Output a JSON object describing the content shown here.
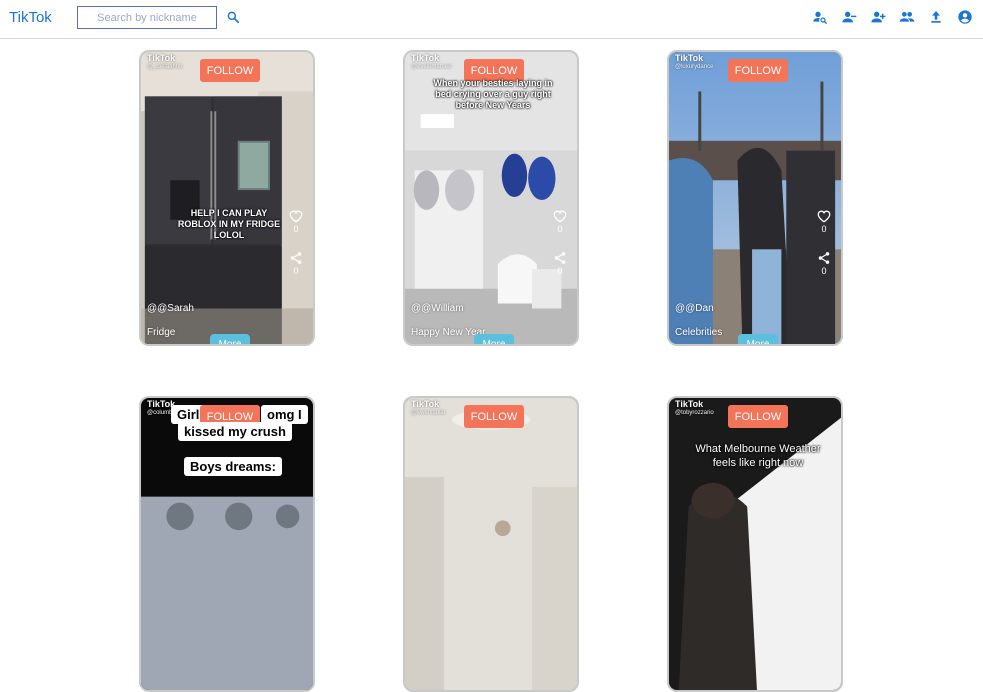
{
  "header": {
    "brand": "TikTok",
    "search_placeholder": "Search by nickname"
  },
  "colors": {
    "brand_blue": "#1976d2",
    "follow_orange": "#f4745a",
    "more_teal": "#5bc0de"
  },
  "toolbar_icons": [
    "person-search-icon",
    "person-remove-icon",
    "person-add-icon",
    "group-icon",
    "upload-icon",
    "account-circle-icon"
  ],
  "cards": [
    {
      "watermark": "TikTok",
      "handle": "@_bellaahhh",
      "follow": "FOLLOW",
      "overlay": [
        "HELP I CAN PLAY",
        "ROBLOX IN MY FRIDGE",
        "LOLOL"
      ],
      "likes": "0",
      "shares": "0",
      "username": "@@Sarah",
      "caption": "Fridge",
      "more": "More"
    },
    {
      "watermark": "TikTok",
      "handle": "@evelemarsee",
      "follow": "FOLLOW",
      "overlay": [
        "When your besties laying in",
        "bed crying over a guy right",
        "before New Years"
      ],
      "likes": "0",
      "shares": "0",
      "username": "@@William",
      "caption": "Happy New Year",
      "more": "More"
    },
    {
      "watermark": "TikTok",
      "handle": "@luxurydance",
      "follow": "FOLLOW",
      "likes": "0",
      "shares": "0",
      "username": "@@Dan",
      "caption": "Celebrities",
      "more": "More"
    },
    {
      "watermark": "TikTok",
      "handle": "@columbe",
      "follow": "FOLLOW",
      "overlay_top": "Girls",
      "overlay_top_right": "omg I",
      "overlay_line2": "kissed my crush",
      "overlay_line3": "Boys dreams:"
    },
    {
      "watermark": "TikTok",
      "handle": "@kwentsulat",
      "follow": "FOLLOW"
    },
    {
      "watermark": "TikTok",
      "handle": "@tobyrozzario",
      "follow": "FOLLOW",
      "overlay": [
        "What Melbourne Weather",
        "feels like right now"
      ]
    }
  ]
}
